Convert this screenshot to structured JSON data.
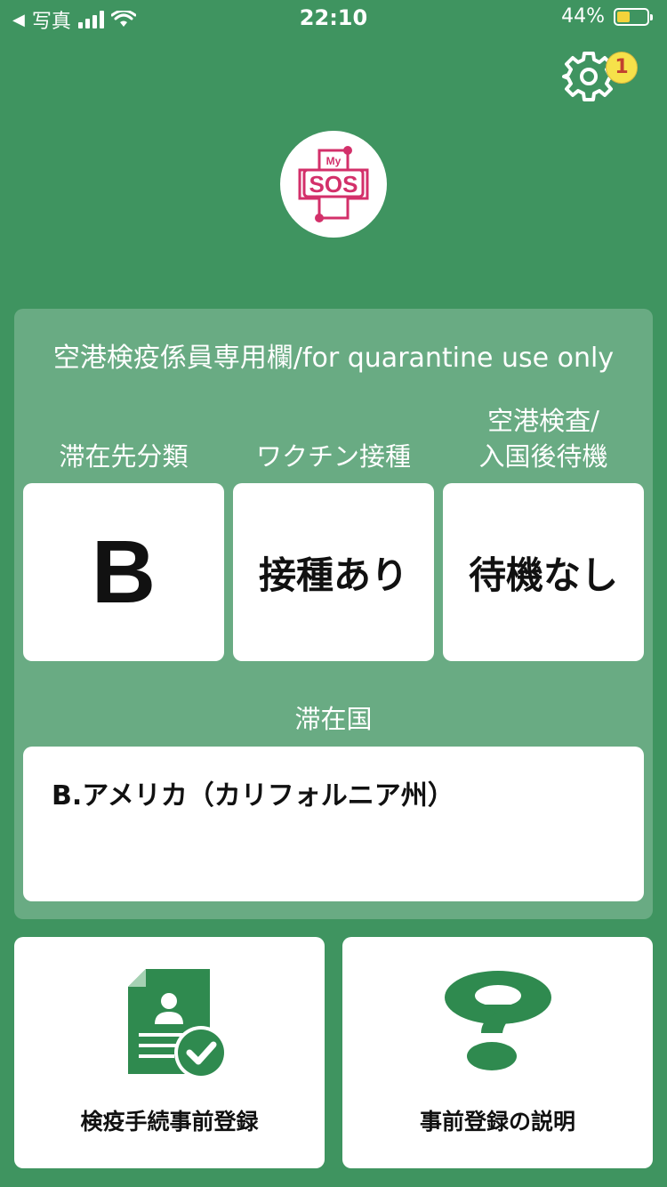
{
  "status_bar": {
    "back_app": "写真",
    "time": "22:10",
    "battery_percent": "44%",
    "battery_level": 0.44,
    "battery_color": "#f3d33b"
  },
  "header": {
    "settings_icon": "gear-icon",
    "settings_badge": "1",
    "logo_top": "My",
    "logo_main": "SOS"
  },
  "panel": {
    "title": "空港検疫係員専用欄/for quarantine use only",
    "columns": [
      {
        "label_lines": [
          "滞在先分類"
        ],
        "value": "B"
      },
      {
        "label_lines": [
          "ワクチン接種"
        ],
        "value": "接種あり"
      },
      {
        "label_lines": [
          "空港検査/",
          "入国後待機"
        ],
        "value": "待機なし"
      }
    ],
    "country_label": "滞在国",
    "country_value": "B.アメリカ（カリフォルニア州）"
  },
  "buttons": [
    {
      "label": "検疫手続事前登録",
      "icon": "document-check-icon"
    },
    {
      "label": "事前登録の説明",
      "icon": "question-mark-icon"
    }
  ],
  "colors": {
    "background": "#3f9460",
    "accent_green": "#2f8a4f",
    "logo_pink": "#d3306a"
  }
}
